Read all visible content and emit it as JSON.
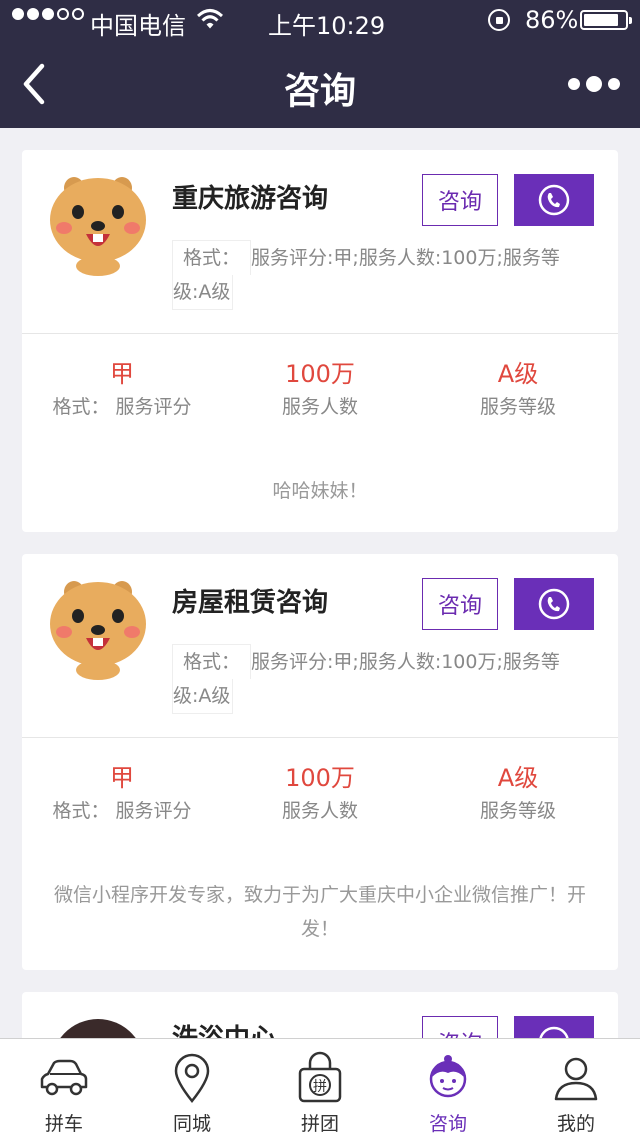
{
  "status_bar": {
    "carrier": "中国电信",
    "time": "上午10:29",
    "battery": "86%",
    "battery_level": 0.86
  },
  "nav": {
    "title": "咨询"
  },
  "cards": [
    {
      "title": "重庆旅游咨询",
      "consult_label": "咨询",
      "desc_tag": "格式：",
      "desc_text": "服务评分:甲;服务人数:100万;服务等",
      "desc_tail": "级:A级",
      "stats": [
        {
          "value": "甲",
          "prefix": "格式：",
          "label": "服务评分"
        },
        {
          "value": "100万",
          "prefix": "",
          "label": "服务人数"
        },
        {
          "value": "A级",
          "prefix": "",
          "label": "服务等级"
        }
      ],
      "intro": "哈哈妹妹！"
    },
    {
      "title": "房屋租赁咨询",
      "consult_label": "咨询",
      "desc_tag": "格式：",
      "desc_text": "服务评分:甲;服务人数:100万;服务等",
      "desc_tail": "级:A级",
      "stats": [
        {
          "value": "甲",
          "prefix": "格式：",
          "label": "服务评分"
        },
        {
          "value": "100万",
          "prefix": "",
          "label": "服务人数"
        },
        {
          "value": "A级",
          "prefix": "",
          "label": "服务等级"
        }
      ],
      "intro": "微信小程序开发专家，致力于为广大重庆中小企业微信推广！开发！"
    },
    {
      "title": "洗浴中心",
      "consult_label": "咨询"
    }
  ],
  "tabs": [
    {
      "label": "拼车",
      "icon": "car-icon"
    },
    {
      "label": "同城",
      "icon": "location-pin-icon"
    },
    {
      "label": "拼团",
      "icon": "group-bag-icon"
    },
    {
      "label": "咨询",
      "icon": "consultant-icon",
      "active": true
    },
    {
      "label": "我的",
      "icon": "profile-icon"
    }
  ],
  "colors": {
    "nav_bg": "#2f2d45",
    "accent": "#6a2fb8",
    "stat_value": "#e0483e"
  }
}
